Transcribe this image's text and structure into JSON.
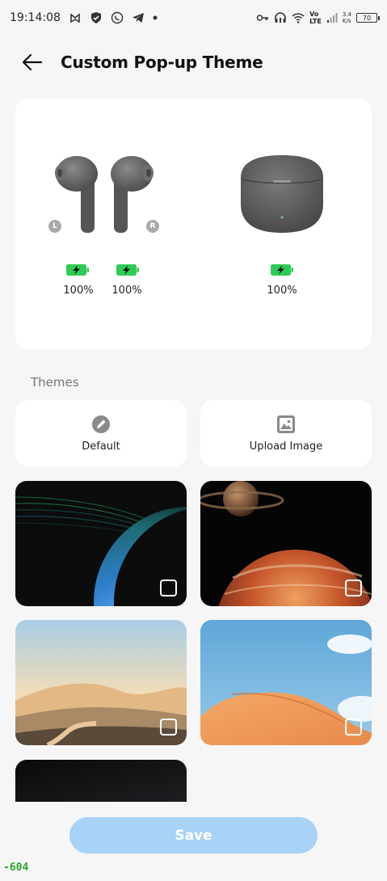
{
  "status_bar": {
    "time": "19:14:08",
    "net_speed_top": "3.4",
    "net_speed_bottom": "K/s",
    "volte_top": "Vo",
    "volte_bottom": "LTE",
    "battery": "70"
  },
  "header": {
    "title": "Custom Pop-up Theme"
  },
  "preview": {
    "left_label": "L",
    "right_label": "R",
    "left_battery": "100%",
    "right_battery": "100%",
    "case_battery": "100%"
  },
  "themes": {
    "section_label": "Themes",
    "default_label": "Default",
    "upload_label": "Upload Image"
  },
  "save_label": "Save",
  "watermark": "-604",
  "colors": {
    "accent_disabled": "#a8d2f6",
    "battery_green": "#2ecc56"
  }
}
